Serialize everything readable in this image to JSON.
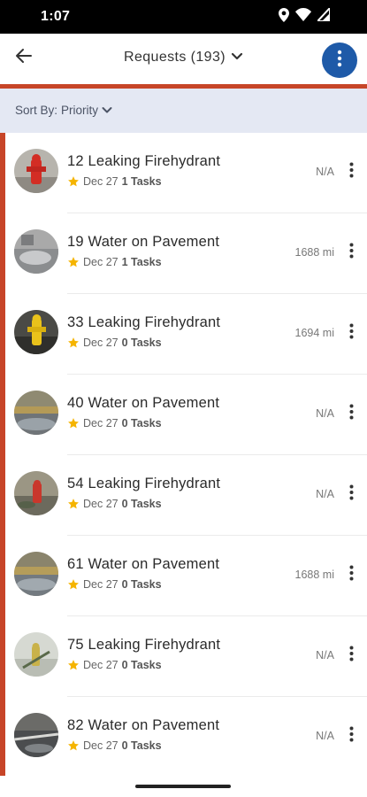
{
  "status_bar": {
    "time": "1:07",
    "icons": [
      "location-icon",
      "wifi-icon",
      "cell-signal-icon"
    ]
  },
  "app_bar": {
    "title": "Requests (193)",
    "accent_color": "#1e5aa8",
    "bar_color": "#c74528"
  },
  "sort": {
    "label": "Sort By:",
    "value": "Priority"
  },
  "requests": [
    {
      "title": "12 Leaking Firehydrant",
      "date": "Dec 27",
      "tasks": "1 Tasks",
      "distance": "N/A"
    },
    {
      "title": "19 Water on Pavement",
      "date": "Dec 27",
      "tasks": "1 Tasks",
      "distance": "1688 mi"
    },
    {
      "title": "33 Leaking Firehydrant",
      "date": "Dec 27",
      "tasks": "0 Tasks",
      "distance": "1694 mi"
    },
    {
      "title": "40 Water on Pavement",
      "date": "Dec 27",
      "tasks": "0 Tasks",
      "distance": "N/A"
    },
    {
      "title": "54 Leaking Firehydrant",
      "date": "Dec 27",
      "tasks": "0 Tasks",
      "distance": "N/A"
    },
    {
      "title": "61 Water on Pavement",
      "date": "Dec 27",
      "tasks": "0 Tasks",
      "distance": "1688 mi"
    },
    {
      "title": "75 Leaking Firehydrant",
      "date": "Dec 27",
      "tasks": "0 Tasks",
      "distance": "N/A"
    },
    {
      "title": "82 Water on Pavement",
      "date": "Dec 27",
      "tasks": "0 Tasks",
      "distance": "N/A"
    }
  ]
}
